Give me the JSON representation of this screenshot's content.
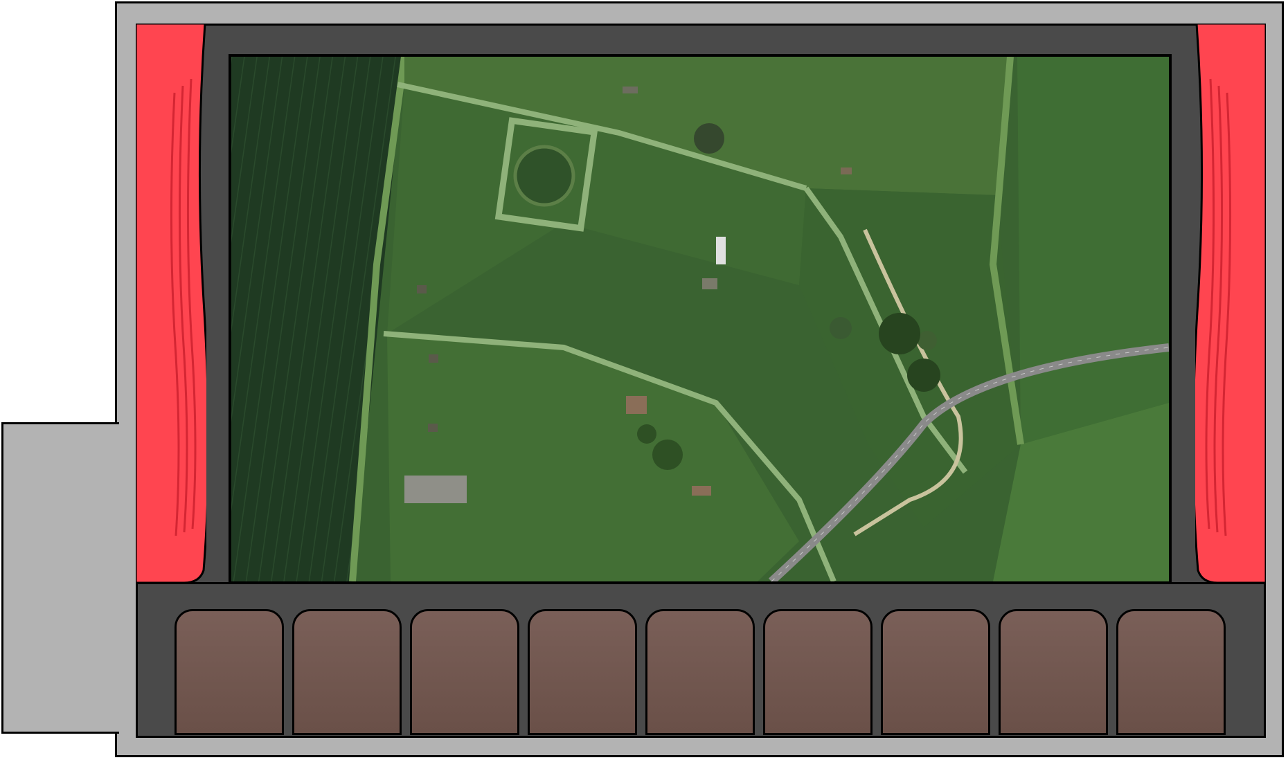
{
  "theater": {
    "colors": {
      "frame": "#b3b3b3",
      "stage": "#4a4a4a",
      "curtain": "#ff4550",
      "curtain_fold": "#d42633",
      "seat": "#735a52",
      "field_dark": "#1f3a22",
      "field_mid": "#36602f",
      "field_light": "#4f7a3a",
      "road": "#8a8a8a"
    },
    "screen": {
      "content": "aerial-farmland-photo"
    },
    "seats": [
      {
        "id": 1
      },
      {
        "id": 2
      },
      {
        "id": 3
      },
      {
        "id": 4
      },
      {
        "id": 5
      },
      {
        "id": 6
      },
      {
        "id": 7
      },
      {
        "id": 8
      },
      {
        "id": 9
      }
    ]
  }
}
